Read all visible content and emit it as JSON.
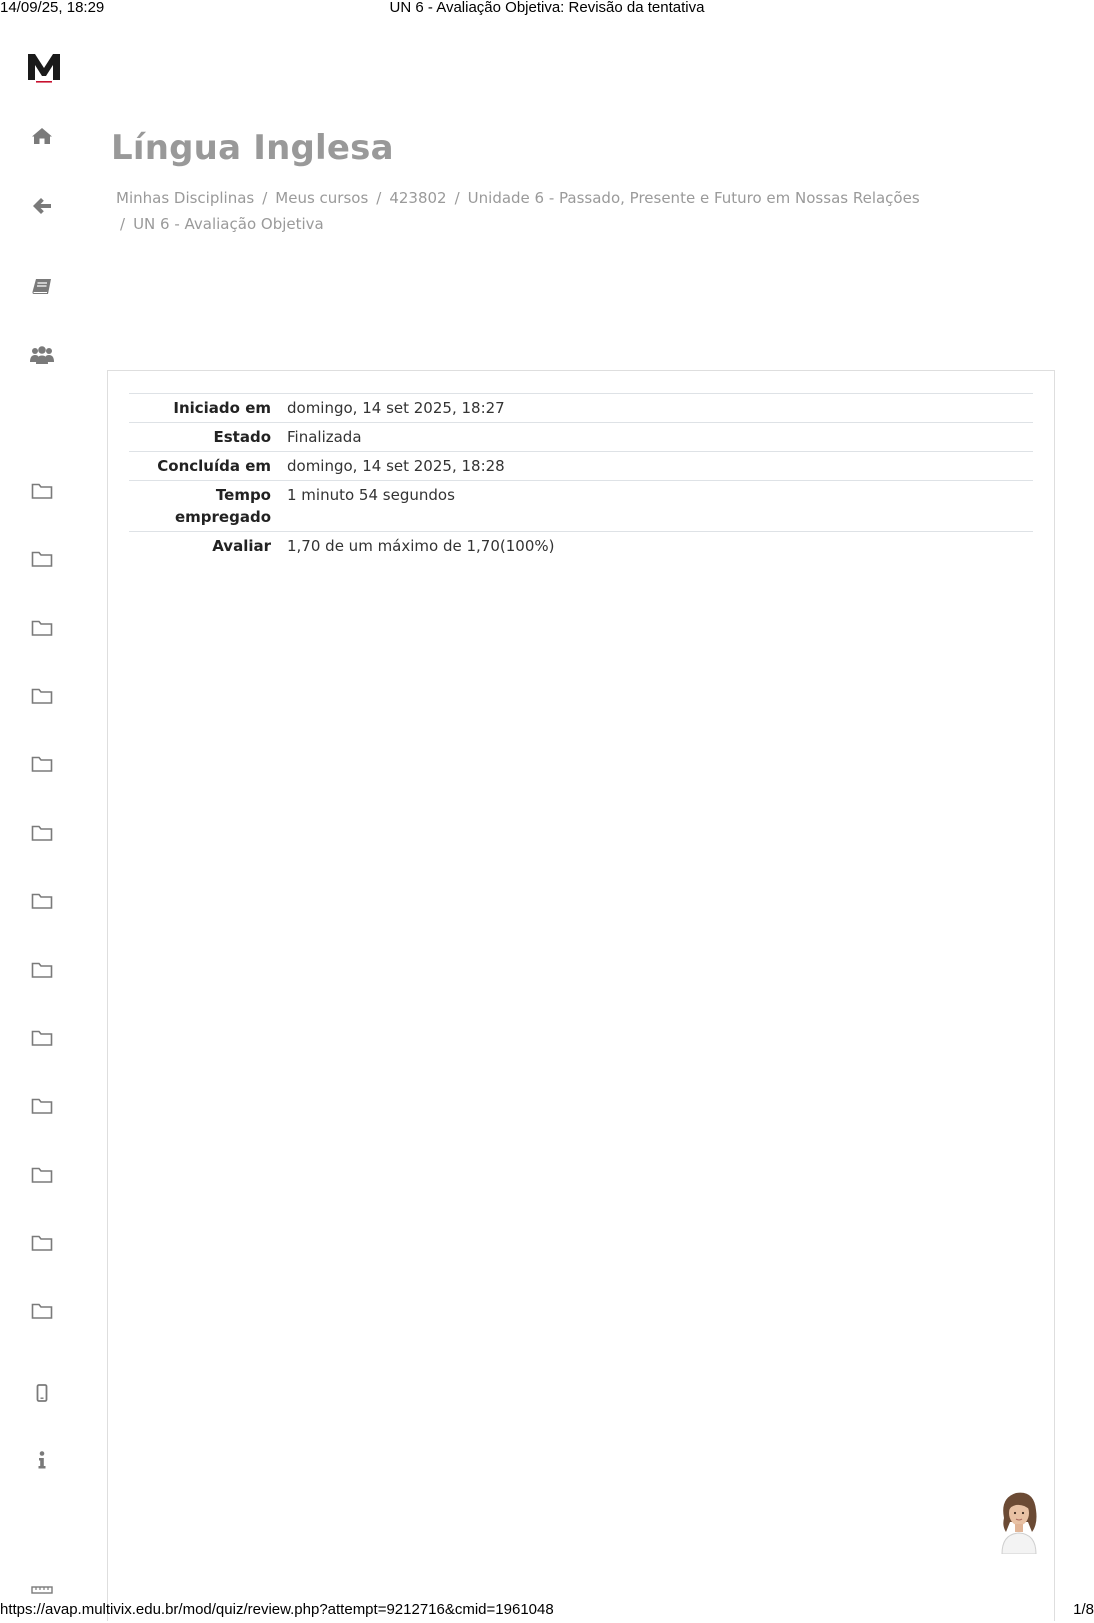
{
  "print_header": {
    "datetime": "14/09/25, 18:29",
    "title": "UN 6 - Avaliação Objetiva: Revisão da tentativa"
  },
  "logo": {
    "letter": "M"
  },
  "sidebar": {
    "items": [
      {
        "name": "home-icon"
      },
      {
        "name": "back-arrow-icon"
      },
      {
        "name": "book-icon"
      },
      {
        "name": "users-icon"
      },
      {
        "name": "folder-icon"
      },
      {
        "name": "folder-icon"
      },
      {
        "name": "folder-icon"
      },
      {
        "name": "folder-icon"
      },
      {
        "name": "folder-icon"
      },
      {
        "name": "folder-icon"
      },
      {
        "name": "folder-icon"
      },
      {
        "name": "folder-icon"
      },
      {
        "name": "folder-icon"
      },
      {
        "name": "folder-icon"
      },
      {
        "name": "folder-icon"
      },
      {
        "name": "folder-icon"
      },
      {
        "name": "folder-icon"
      },
      {
        "name": "mobile-icon"
      },
      {
        "name": "info-icon"
      },
      {
        "name": "ruler-icon"
      }
    ]
  },
  "course": {
    "title": "Língua Inglesa"
  },
  "breadcrumb": [
    "Minhas Disciplinas",
    "Meus cursos",
    "423802",
    "Unidade 6 - Passado, Presente e Futuro em Nossas Relações",
    "UN 6 - Avaliação Objetiva"
  ],
  "summary": {
    "rows": [
      {
        "label": "Iniciado em",
        "value": "domingo, 14 set 2025, 18:27"
      },
      {
        "label": "Estado",
        "value": "Finalizada"
      },
      {
        "label": "Concluída em",
        "value": "domingo, 14 set 2025, 18:28"
      },
      {
        "label": "Tempo empregado",
        "value": "1 minuto 54 segundos"
      },
      {
        "label": "Avaliar",
        "value": "1,70 de um máximo de 1,70(100%)"
      }
    ]
  },
  "print_footer": {
    "url": "https://avap.multivix.edu.br/mod/quiz/review.php?attempt=9212716&cmid=1961048",
    "page": "1/8"
  },
  "colors": {
    "title_gray": "#999999",
    "breadcrumb_gray": "#9a9a9a",
    "icon_gray": "#7a7a7a",
    "logo_dark": "#1a1a1a",
    "logo_accent": "#c8102e"
  }
}
